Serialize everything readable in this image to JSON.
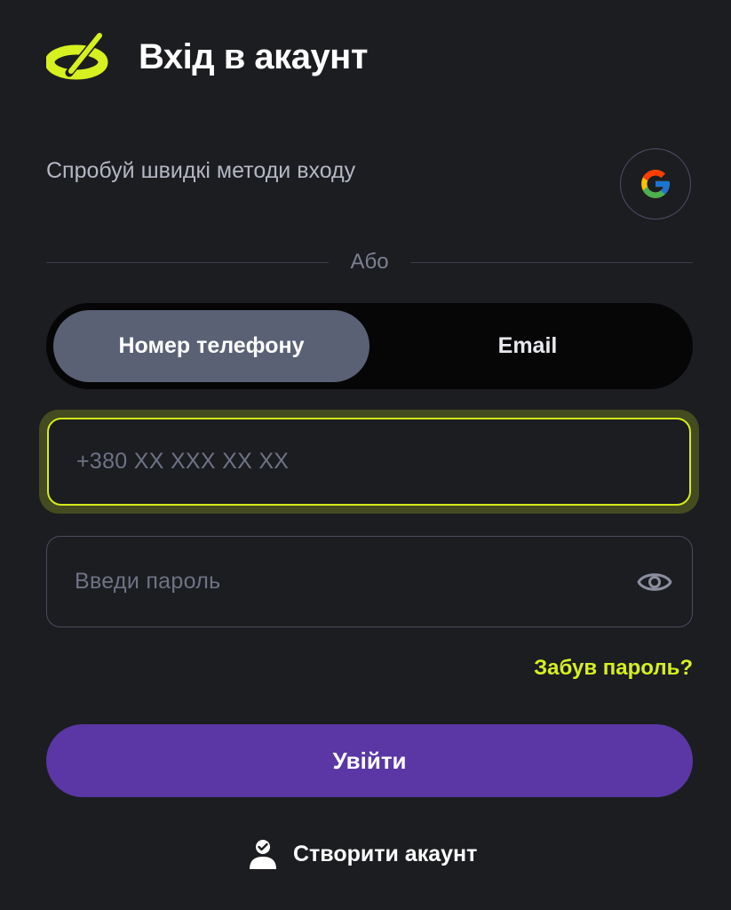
{
  "header": {
    "logo_icon": "brand-logo-icon",
    "title": "Вхід в акаунт"
  },
  "quick_login": {
    "text": "Спробуй швидкі методи входу",
    "google_icon": "google-icon"
  },
  "divider": {
    "text": "Або"
  },
  "login_method_toggle": {
    "options": [
      {
        "label": "Номер телефону",
        "selected": true
      },
      {
        "label": "Email",
        "selected": false
      }
    ]
  },
  "phone_field": {
    "value": "",
    "placeholder": "+380 XX XXX XX XX"
  },
  "password_field": {
    "value": "",
    "placeholder": "Введи пароль",
    "toggle_icon": "eye-icon"
  },
  "forgot_password": {
    "label": "Забув пароль?"
  },
  "submit": {
    "label": "Увійти"
  },
  "create_account": {
    "icon": "user-check-icon",
    "label": "Створити акаунт"
  },
  "colors": {
    "background": "#1c1d21",
    "accent": "#d6f020",
    "primary_button": "#5a37a4",
    "toggle_selected": "#5a6175",
    "toggle_track": "#060607"
  }
}
